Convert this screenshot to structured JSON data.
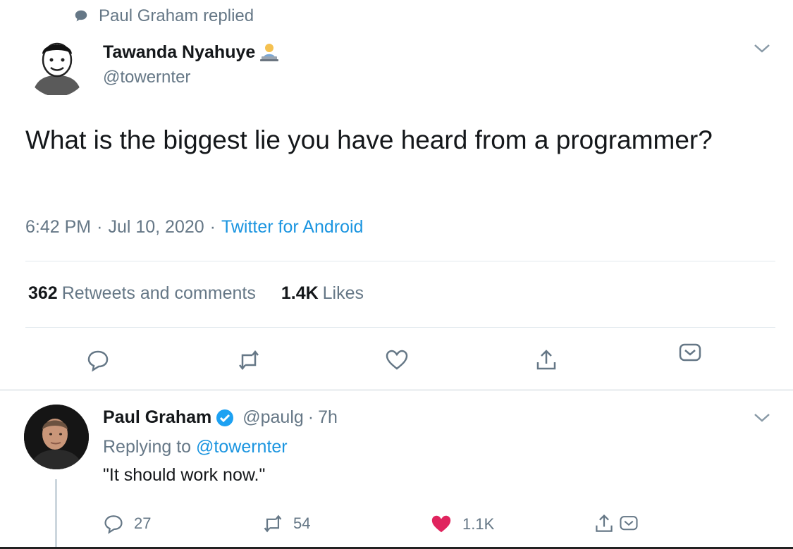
{
  "context": {
    "label": "Paul Graham replied",
    "icon": "speech-bubble-icon"
  },
  "tweet": {
    "author_name": "Tawanda Nyahuye",
    "author_emoji_icon": "technologist-emoji-icon",
    "author_handle": "@towernter",
    "text": "What is the biggest lie you have heard from a programmer?",
    "time": "6:42 PM",
    "date": "Jul 10, 2020",
    "source": "Twitter for Android",
    "retweets_count": "362",
    "retweets_label": "Retweets and comments",
    "likes_count": "1.4K",
    "likes_label": "Likes",
    "actions": [
      "reply-icon",
      "retweet-icon",
      "like-icon",
      "share-icon",
      "dm-icon"
    ]
  },
  "reply": {
    "author_name": "Paul Graham",
    "verified_icon": "verified-badge-icon",
    "author_handle": "@paulg",
    "time": "7h",
    "replying_prefix": "Replying to",
    "replying_handle": "@towernter",
    "text": "\"It should work now.\"",
    "reply_count": "27",
    "retweet_count": "54",
    "like_count": "1.1K"
  },
  "colors": {
    "accent": "#1b95e0",
    "like": "#e0245e",
    "muted": "#657786",
    "text": "#14171a"
  }
}
